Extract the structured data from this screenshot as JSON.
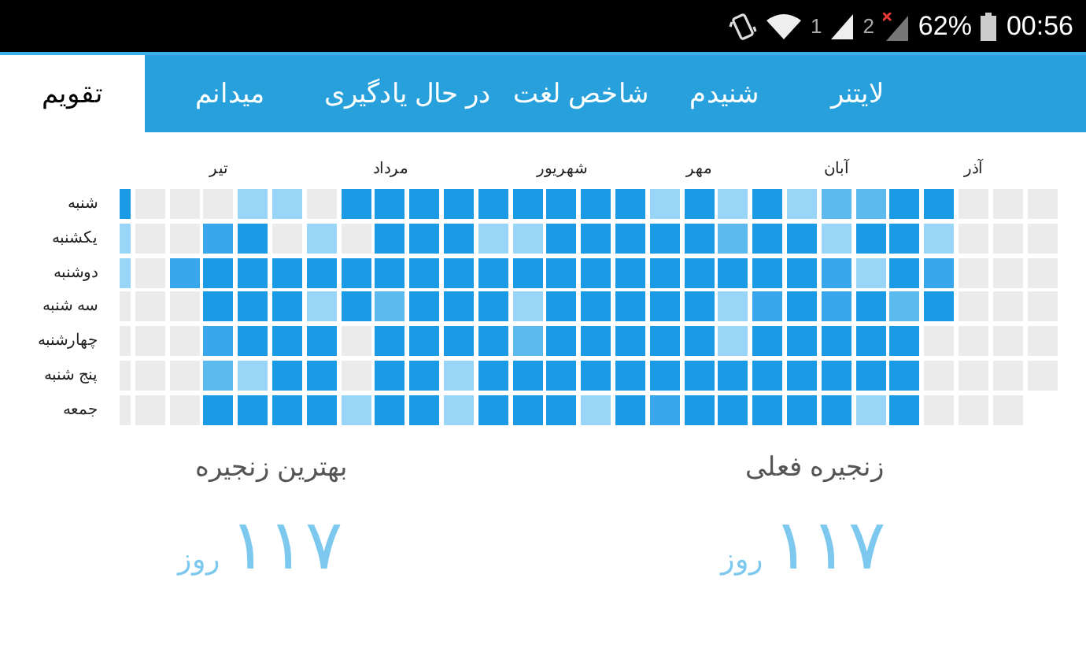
{
  "status_bar": {
    "sim_1": "1",
    "sim_2": "2",
    "battery": "62%",
    "time": "00:56"
  },
  "tabs": [
    {
      "label": "لایتنر",
      "selected": false
    },
    {
      "label": "شنیدم",
      "selected": false
    },
    {
      "label": "شاخص لغت",
      "selected": false
    },
    {
      "label": "در حال یادگیری",
      "selected": false
    },
    {
      "label": "میدانم",
      "selected": false
    },
    {
      "label": "تقویم",
      "selected": true
    }
  ],
  "calendar": {
    "months": [
      "آذر",
      "آبان",
      "مهر",
      "شهریور",
      "مرداد",
      "تیر"
    ],
    "days": [
      "شنبه",
      "یکشنبه",
      "دوشنبه",
      "سه شنبه",
      "چهارشنبه",
      "پنج شنبه",
      "جمعه"
    ],
    "weeks": [
      {
        "cells": [
          {
            "color": "#1b9ae5"
          },
          {
            "color": "#98d5f6"
          },
          {
            "color": "#98d5f6"
          },
          {
            "color": "#ebebeb"
          },
          {
            "color": "#ebebeb"
          },
          {
            "color": "#ebebeb"
          },
          {
            "color": "#ebebeb"
          }
        ]
      },
      {
        "cells": [
          {
            "color": "#ebebeb"
          },
          {
            "color": "#ebebeb"
          },
          {
            "color": "#ebebeb"
          },
          {
            "color": "#ebebeb"
          },
          {
            "color": "#ebebeb"
          },
          {
            "color": "#ebebeb"
          },
          {
            "color": "#ebebeb"
          }
        ]
      },
      {
        "cells": [
          {
            "color": "#ebebeb"
          },
          {
            "color": "#ebebeb"
          },
          {
            "color": "#38a6ea"
          },
          {
            "color": "#ebebeb"
          },
          {
            "color": "#ebebeb"
          },
          {
            "color": "#ebebeb"
          },
          {
            "color": "#ebebeb"
          }
        ]
      },
      {
        "cells": [
          {
            "color": "#ebebeb"
          },
          {
            "color": "#38a6ea"
          },
          {
            "color": "#1b9ae5"
          },
          {
            "color": "#1b9ae5"
          },
          {
            "color": "#38a6ea"
          },
          {
            "color": "#5cbaef"
          },
          {
            "color": "#1b9ae5"
          }
        ]
      },
      {
        "cells": [
          {
            "color": "#98d5f6"
          },
          {
            "color": "#1b9ae5"
          },
          {
            "color": "#1b9ae5"
          },
          {
            "color": "#1b9ae5"
          },
          {
            "color": "#1b9ae5"
          },
          {
            "color": "#98d5f6"
          },
          {
            "color": "#1b9ae5"
          }
        ]
      },
      {
        "cells": [
          {
            "color": "#98d5f6"
          },
          {
            "color": "#ebebeb"
          },
          {
            "color": "#1b9ae5"
          },
          {
            "color": "#1b9ae5"
          },
          {
            "color": "#1b9ae5"
          },
          {
            "color": "#1b9ae5"
          },
          {
            "color": "#1b9ae5"
          }
        ]
      },
      {
        "cells": [
          {
            "color": "#ebebeb"
          },
          {
            "color": "#98d5f6"
          },
          {
            "color": "#1b9ae5"
          },
          {
            "color": "#98d5f6"
          },
          {
            "color": "#1b9ae5"
          },
          {
            "color": "#1b9ae5"
          },
          {
            "color": "#1b9ae5"
          }
        ]
      },
      {
        "cells": [
          {
            "color": "#1b9ae5"
          },
          {
            "color": "#ebebeb"
          },
          {
            "color": "#1b9ae5"
          },
          {
            "color": "#1b9ae5"
          },
          {
            "color": "#ebebeb"
          },
          {
            "color": "#ebebeb"
          },
          {
            "color": "#98d5f6"
          }
        ]
      },
      {
        "cells": [
          {
            "color": "#1b9ae5"
          },
          {
            "color": "#1b9ae5"
          },
          {
            "color": "#1b9ae5"
          },
          {
            "color": "#5cbaef"
          },
          {
            "color": "#1b9ae5"
          },
          {
            "color": "#1b9ae5"
          },
          {
            "color": "#1b9ae5"
          }
        ]
      },
      {
        "cells": [
          {
            "color": "#1b9ae5"
          },
          {
            "color": "#1b9ae5"
          },
          {
            "color": "#1b9ae5"
          },
          {
            "color": "#1b9ae5"
          },
          {
            "color": "#1b9ae5"
          },
          {
            "color": "#1b9ae5"
          },
          {
            "color": "#1b9ae5"
          }
        ]
      },
      {
        "cells": [
          {
            "color": "#1b9ae5"
          },
          {
            "color": "#1b9ae5"
          },
          {
            "color": "#1b9ae5"
          },
          {
            "color": "#1b9ae5"
          },
          {
            "color": "#1b9ae5"
          },
          {
            "color": "#98d5f6"
          },
          {
            "color": "#98d5f6"
          }
        ]
      },
      {
        "cells": [
          {
            "color": "#1b9ae5"
          },
          {
            "color": "#98d5f6"
          },
          {
            "color": "#1b9ae5"
          },
          {
            "color": "#1b9ae5"
          },
          {
            "color": "#1b9ae5"
          },
          {
            "color": "#1b9ae5"
          },
          {
            "color": "#1b9ae5"
          }
        ]
      },
      {
        "cells": [
          {
            "color": "#1b9ae5"
          },
          {
            "color": "#98d5f6"
          },
          {
            "color": "#1b9ae5"
          },
          {
            "color": "#98d5f6"
          },
          {
            "color": "#5cbaef"
          },
          {
            "color": "#1b9ae5"
          },
          {
            "color": "#1b9ae5"
          }
        ]
      },
      {
        "cells": [
          {
            "color": "#1b9ae5"
          },
          {
            "color": "#1b9ae5"
          },
          {
            "color": "#1b9ae5"
          },
          {
            "color": "#1b9ae5"
          },
          {
            "color": "#1b9ae5"
          },
          {
            "color": "#1b9ae5"
          },
          {
            "color": "#1b9ae5"
          }
        ]
      },
      {
        "cells": [
          {
            "color": "#1b9ae5"
          },
          {
            "color": "#1b9ae5"
          },
          {
            "color": "#1b9ae5"
          },
          {
            "color": "#1b9ae5"
          },
          {
            "color": "#1b9ae5"
          },
          {
            "color": "#1b9ae5"
          },
          {
            "color": "#98d5f6"
          }
        ]
      },
      {
        "cells": [
          {
            "color": "#1b9ae5"
          },
          {
            "color": "#1b9ae5"
          },
          {
            "color": "#1b9ae5"
          },
          {
            "color": "#1b9ae5"
          },
          {
            "color": "#1b9ae5"
          },
          {
            "color": "#1b9ae5"
          },
          {
            "color": "#1b9ae5"
          }
        ]
      },
      {
        "cells": [
          {
            "color": "#98d5f6"
          },
          {
            "color": "#1b9ae5"
          },
          {
            "color": "#1b9ae5"
          },
          {
            "color": "#1b9ae5"
          },
          {
            "color": "#1b9ae5"
          },
          {
            "color": "#1b9ae5"
          },
          {
            "color": "#38a6ea"
          }
        ]
      },
      {
        "cells": [
          {
            "color": "#1b9ae5"
          },
          {
            "color": "#1b9ae5"
          },
          {
            "color": "#1b9ae5"
          },
          {
            "color": "#1b9ae5"
          },
          {
            "color": "#1b9ae5"
          },
          {
            "color": "#1b9ae5"
          },
          {
            "color": "#1b9ae5"
          }
        ]
      },
      {
        "cells": [
          {
            "color": "#98d5f6"
          },
          {
            "color": "#5cbaef"
          },
          {
            "color": "#1b9ae5"
          },
          {
            "color": "#98d5f6"
          },
          {
            "color": "#98d5f6"
          },
          {
            "color": "#1b9ae5"
          },
          {
            "color": "#1b9ae5"
          }
        ]
      },
      {
        "cells": [
          {
            "color": "#1b9ae5"
          },
          {
            "color": "#1b9ae5"
          },
          {
            "color": "#1b9ae5"
          },
          {
            "color": "#38a6ea"
          },
          {
            "color": "#1b9ae5"
          },
          {
            "color": "#1b9ae5"
          },
          {
            "color": "#1b9ae5"
          }
        ]
      },
      {
        "cells": [
          {
            "color": "#98d5f6"
          },
          {
            "color": "#1b9ae5"
          },
          {
            "color": "#1b9ae5"
          },
          {
            "color": "#1b9ae5"
          },
          {
            "color": "#1b9ae5"
          },
          {
            "color": "#1b9ae5"
          },
          {
            "color": "#1b9ae5"
          }
        ]
      },
      {
        "cells": [
          {
            "color": "#5cbaef"
          },
          {
            "color": "#98d5f6"
          },
          {
            "color": "#38a6ea"
          },
          {
            "color": "#38a6ea"
          },
          {
            "color": "#1b9ae5"
          },
          {
            "color": "#1b9ae5"
          },
          {
            "color": "#1b9ae5"
          }
        ]
      },
      {
        "cells": [
          {
            "color": "#5cbaef"
          },
          {
            "color": "#1b9ae5"
          },
          {
            "color": "#98d5f6"
          },
          {
            "color": "#1b9ae5"
          },
          {
            "color": "#1b9ae5"
          },
          {
            "color": "#1b9ae5"
          },
          {
            "color": "#98d5f6"
          }
        ]
      },
      {
        "cells": [
          {
            "color": "#1b9ae5"
          },
          {
            "color": "#1b9ae5"
          },
          {
            "color": "#1b9ae5"
          },
          {
            "color": "#5cbaef"
          },
          {
            "color": "#1b9ae5"
          },
          {
            "color": "#1b9ae5"
          },
          {
            "color": "#1b9ae5"
          }
        ]
      },
      {
        "cells": [
          {
            "color": "#1b9ae5"
          },
          {
            "color": "#98d5f6"
          },
          {
            "color": "#38a6ea"
          },
          {
            "color": "#1b9ae5"
          },
          {
            "color": "#ebebeb"
          },
          {
            "color": "#ebebeb"
          },
          {
            "color": "#ebebeb"
          }
        ]
      },
      {
        "cells": [
          {
            "color": "#ebebeb"
          },
          {
            "color": "#ebebeb"
          },
          {
            "color": "#ebebeb"
          },
          {
            "color": "#ebebeb"
          },
          {
            "color": "#ebebeb"
          },
          {
            "color": "#ebebeb"
          },
          {
            "color": "#ebebeb"
          }
        ]
      },
      {
        "cells": [
          {
            "color": "#ebebeb"
          },
          {
            "color": "#ebebeb"
          },
          {
            "color": "#ebebeb"
          },
          {
            "color": "#ebebeb"
          },
          {
            "color": "#ebebeb"
          },
          {
            "color": "#ebebeb"
          },
          {
            "color": "#ebebeb"
          }
        ]
      },
      {
        "cells": [
          {
            "color": "#ebebeb"
          },
          {
            "color": "#ebebeb"
          },
          {
            "color": "#ebebeb"
          },
          {
            "color": "#ebebeb"
          },
          {
            "color": "#ebebeb"
          },
          {
            "color": "#ebebeb"
          }
        ]
      }
    ]
  },
  "streaks": [
    {
      "title": "زنجیره فعلی",
      "value": "۱۱۷",
      "unit": "روز"
    },
    {
      "title": "بهترین زنجیره",
      "value": "۱۱۷",
      "unit": "روز"
    }
  ]
}
